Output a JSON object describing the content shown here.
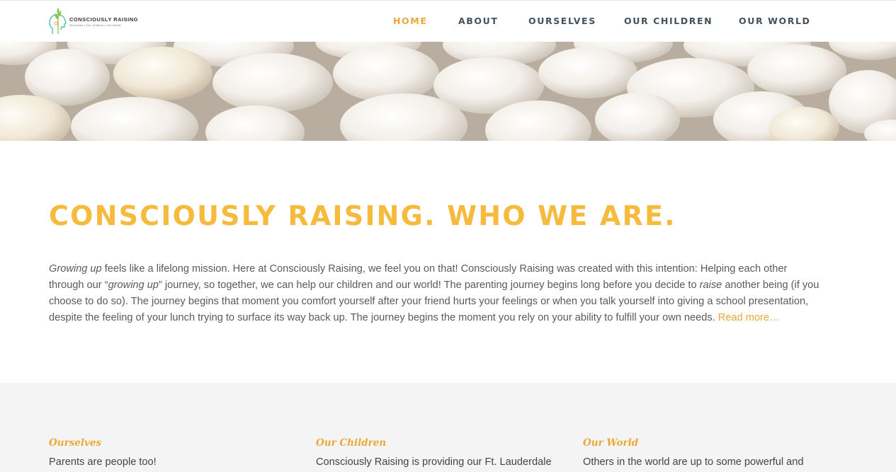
{
  "header": {
    "logo_title": "CONSCIOUSLY RAISING",
    "logo_tagline": "Ourselves | Our Children | Our World",
    "nav": [
      {
        "label": "HOME",
        "active": true
      },
      {
        "label": "ABOUT",
        "active": false
      },
      {
        "label": "OURSELVES",
        "active": false
      },
      {
        "label": "OUR CHILDREN",
        "active": false
      },
      {
        "label": "OUR WORLD",
        "active": false
      }
    ]
  },
  "intro": {
    "title": "CONSCIOUSLY RAISING. WHO WE ARE.",
    "p1_em": "Growing up",
    "p2": " feels like a lifelong mission. Here at Consciously Raising, we feel you on that! Consciously Raising was created with this intention: Helping each other through our “",
    "p3_em": "growing up",
    "p4": "” journey, so together, we can help our children and our world! The parenting journey begins long before you decide to ",
    "p5_em": "raise",
    "p6": " another being (if you choose to do so). The journey begins that moment you comfort yourself after your friend hurts your feelings or when you talk yourself into giving a school presentation, despite the feeling of your lunch trying to surface its way back up. The journey begins the moment you rely on your ability to fulfill your own needs. ",
    "read_more": "Read more…"
  },
  "features": [
    {
      "title": "Ourselves",
      "text": "Parents are people too!"
    },
    {
      "title": "Our Children",
      "text": "Consciously Raising is providing our Ft. Lauderdale"
    },
    {
      "title": "Our World",
      "text": "Others in the world are up to some powerful and"
    }
  ],
  "colors": {
    "accent": "#eaa83a",
    "title_yellow": "#f6bb3d",
    "nav_text": "#44505a",
    "section_bg": "#f4f4f4"
  },
  "icons": {
    "logo": "head-with-sprout-icon"
  }
}
